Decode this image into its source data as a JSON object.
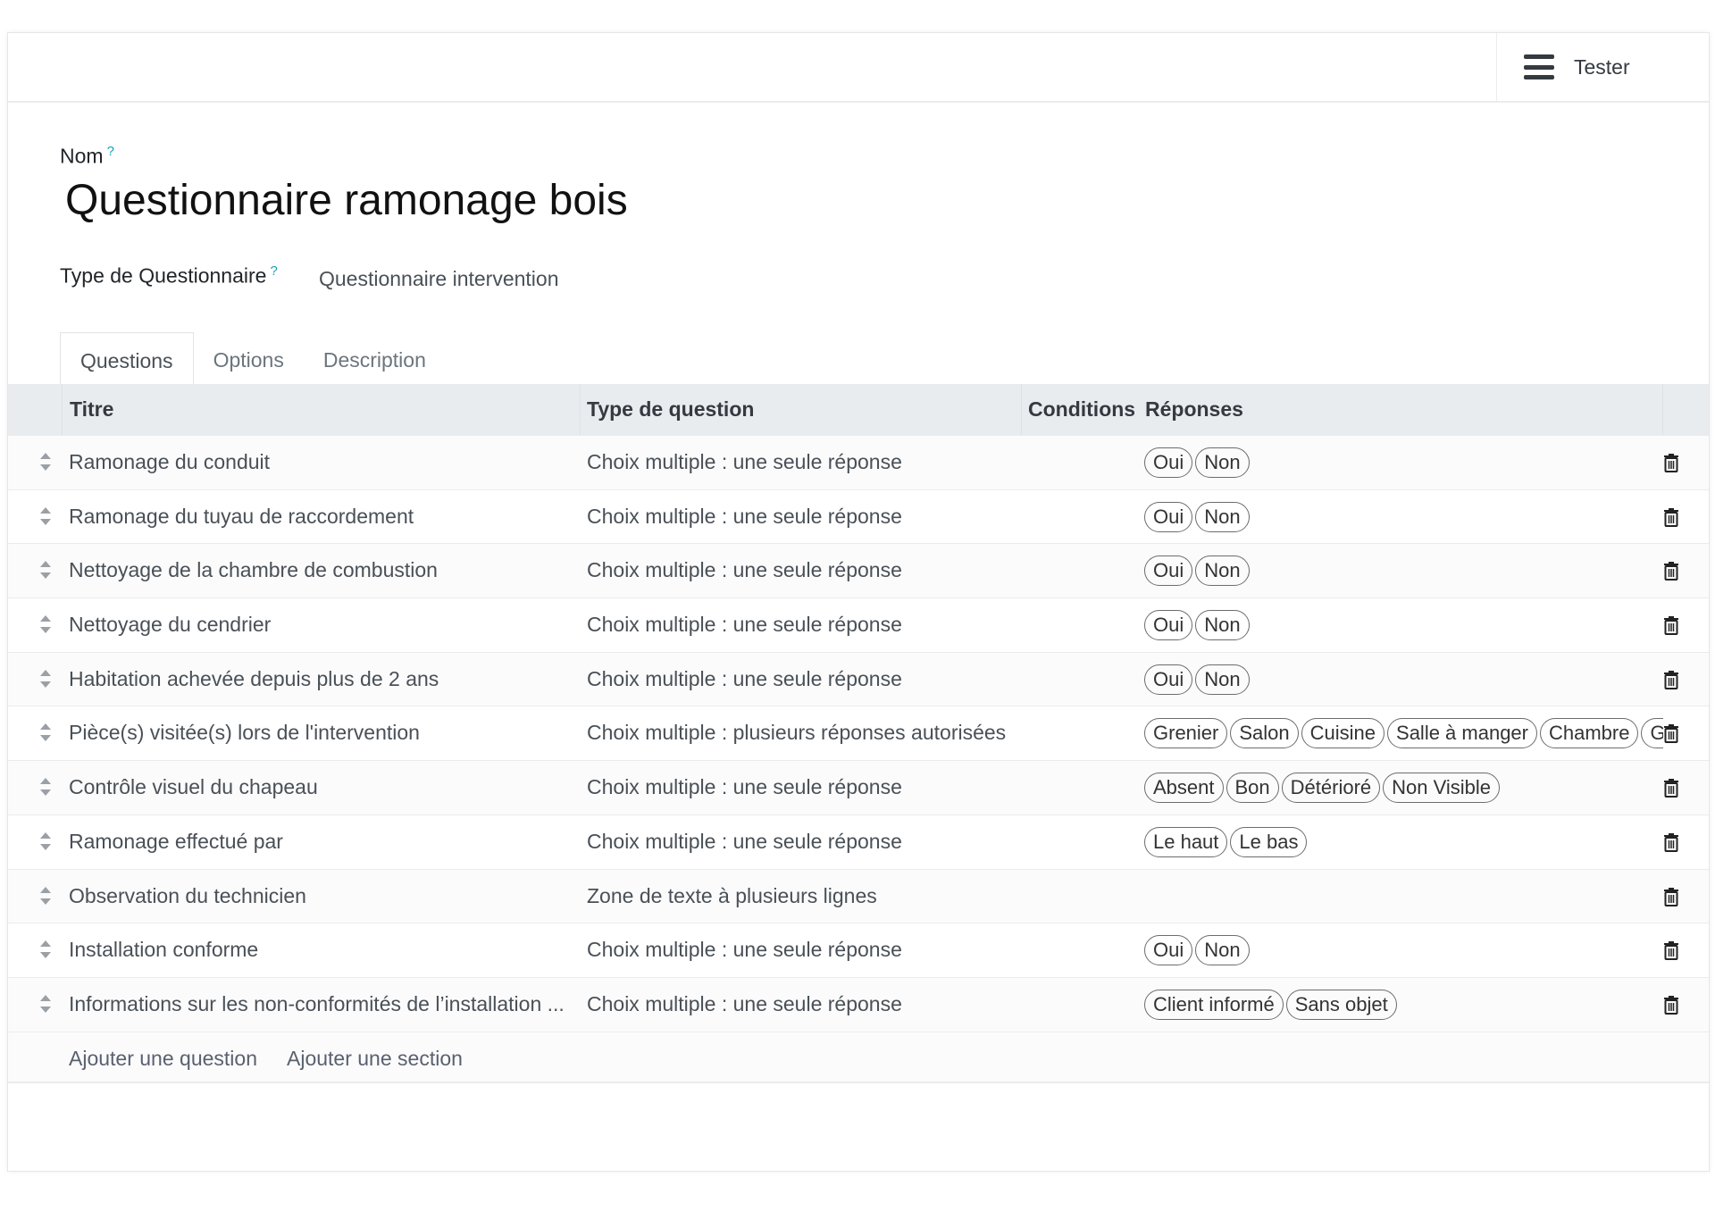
{
  "header": {
    "tester_label": "Tester",
    "menu_icon": "hamburger-icon"
  },
  "form": {
    "name_label": "Nom",
    "help_mark": "?",
    "name_value": "Questionnaire ramonage bois",
    "type_label": "Type de Questionnaire",
    "type_value": "Questionnaire intervention"
  },
  "tabs": [
    {
      "label": "Questions",
      "active": true
    },
    {
      "label": "Options"
    },
    {
      "label": "Description"
    }
  ],
  "table": {
    "columns": [
      "Titre",
      "Type de question",
      "Conditions",
      "Réponses"
    ],
    "rows": [
      {
        "title": "Ramonage du conduit",
        "type": "Choix multiple : une seule réponse",
        "answers": [
          "Oui",
          "Non"
        ]
      },
      {
        "title": "Ramonage du tuyau de raccordement",
        "type": "Choix multiple : une seule réponse",
        "answers": [
          "Oui",
          "Non"
        ]
      },
      {
        "title": "Nettoyage de la chambre de combustion",
        "type": "Choix multiple : une seule réponse",
        "answers": [
          "Oui",
          "Non"
        ]
      },
      {
        "title": "Nettoyage du cendrier",
        "type": "Choix multiple : une seule réponse",
        "answers": [
          "Oui",
          "Non"
        ]
      },
      {
        "title": "Habitation achevée depuis plus de 2 ans",
        "type": "Choix multiple : une seule réponse",
        "answers": [
          "Oui",
          "Non"
        ]
      },
      {
        "title": "Pièce(s) visitée(s) lors de l'intervention",
        "type": "Choix multiple : plusieurs réponses autorisées",
        "answers": [
          "Grenier",
          "Salon",
          "Cuisine",
          "Salle à manger",
          "Chambre",
          "Ga"
        ]
      },
      {
        "title": "Contrôle visuel du chapeau",
        "type": "Choix multiple : une seule réponse",
        "answers": [
          "Absent",
          "Bon",
          "Détérioré",
          "Non Visible"
        ]
      },
      {
        "title": "Ramonage effectué par",
        "type": "Choix multiple : une seule réponse",
        "answers": [
          "Le haut",
          "Le bas"
        ]
      },
      {
        "title": "Observation du technicien",
        "type": "Zone de texte à plusieurs lignes",
        "answers": []
      },
      {
        "title": "Installation conforme",
        "type": "Choix multiple : une seule réponse",
        "answers": [
          "Oui",
          "Non"
        ]
      },
      {
        "title": "Informations sur les non-conformités de l’installation ...",
        "type": "Choix multiple : une seule réponse",
        "answers": [
          "Client informé",
          "Sans objet"
        ]
      }
    ]
  },
  "footer": {
    "add_question": "Ajouter une question",
    "add_section": "Ajouter une section"
  }
}
